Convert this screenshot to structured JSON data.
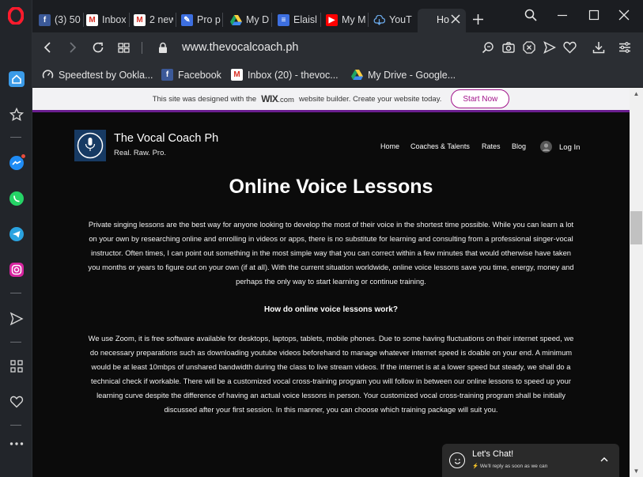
{
  "browser": {
    "tabs": [
      {
        "label": "(3) 50",
        "icon": "facebook-icon",
        "color": "#3b5998"
      },
      {
        "label": "Inbox",
        "icon": "gmail-icon",
        "color": "#d93025"
      },
      {
        "label": "2 new",
        "icon": "gmail-icon",
        "color": "#d93025"
      },
      {
        "label": "Pro p",
        "icon": "tool-icon",
        "color": "#3d6fe0"
      },
      {
        "label": "My D",
        "icon": "google-drive-icon",
        "color": "#1fa463"
      },
      {
        "label": "Elaisl",
        "icon": "docs-icon",
        "color": "#3d6fe0"
      },
      {
        "label": "My M",
        "icon": "youtube-icon",
        "color": "#ff0000"
      },
      {
        "label": "YouT",
        "icon": "download-cloud-icon",
        "color": "#4a90d9"
      },
      {
        "label": "Ho",
        "icon": "",
        "color": "#2b2e33"
      }
    ],
    "active_tab_index": 8,
    "url": "www.thevocalcoach.ph",
    "bookmarks": [
      {
        "label": "Speedtest by Ookla...",
        "icon": "speedtest-icon"
      },
      {
        "label": "Facebook",
        "icon": "facebook-icon"
      },
      {
        "label": "Inbox (20) - thevoc...",
        "icon": "gmail-icon"
      },
      {
        "label": "My Drive - Google...",
        "icon": "google-drive-icon"
      }
    ]
  },
  "wix_banner": {
    "text_before": "This site was designed with the",
    "brand": "WIX",
    "brand_suffix": ".com",
    "text_after": "website builder. Create your website today.",
    "button": "Start Now",
    "accent": "#a2148b"
  },
  "site": {
    "name": "The Vocal Coach Ph",
    "tagline": "Real. Raw. Pro.",
    "logo_text": "The Vocal Coach",
    "menu": [
      "Home",
      "Coaches & Talents",
      "Rates",
      "Blog"
    ],
    "login": "Log In"
  },
  "content": {
    "heading": "Online Voice Lessons",
    "intro": "Private singing lessons are the best way for anyone looking to develop the most of their voice in the shortest time possible. While you can learn a lot on your own by researching online and enrolling in videos or apps, there is no substitute for learning and consulting from a professional singer-vocal instructor. Often times, I can point out something in the most simple way that you can correct within a few minutes that would otherwise have taken you months or years to figure out on your own (if at all). With the current situation worldwide, online voice lessons save you time, energy, money and perhaps the only way to start learning or continue training.",
    "subheading": "How do online voice lessons work?",
    "body": "We use Zoom, it is free software available for desktops, laptops, tablets, mobile phones. Due to some having fluctuations on their internet speed, we do necessary preparations such as downloading youtube videos beforehand to manage whatever internet speed is doable on your end. A minimum would be at least 10mbps of unshared bandwidth during the class to live stream videos. If the internet is at a lower speed but steady, we shall do a technical check if workable. There will be a customized vocal cross-training program you will follow in between our online lessons to speed up your learning curve despite the difference of having an actual voice lessons in person. Your customized vocal cross-training program shall be initially discussed after your first session. In this manner, you can choose which training package will suit you."
  },
  "chat": {
    "title": "Let's Chat!",
    "subtitle": "We'll reply as soon as we can"
  }
}
